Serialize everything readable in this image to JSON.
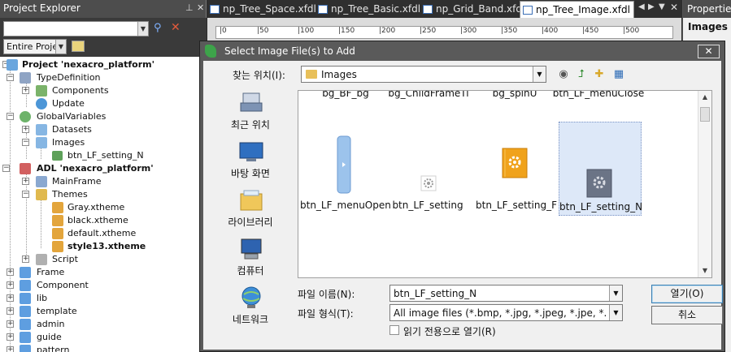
{
  "explorer": {
    "title": "Project Explorer",
    "scope_select": "Entire Projec",
    "tree": [
      {
        "label": "Project 'nexacro_platform'",
        "bold": true
      },
      {
        "label": "TypeDefinition"
      },
      {
        "label": "Components"
      },
      {
        "label": "Update"
      },
      {
        "label": "GlobalVariables"
      },
      {
        "label": "Datasets"
      },
      {
        "label": "Images"
      },
      {
        "label": "btn_LF_setting_N"
      },
      {
        "label": "ADL 'nexacro_platform'",
        "bold": true
      },
      {
        "label": "MainFrame"
      },
      {
        "label": "Themes"
      },
      {
        "label": "Gray.xtheme"
      },
      {
        "label": "black.xtheme"
      },
      {
        "label": "default.xtheme"
      },
      {
        "label": "style13.xtheme",
        "bold": true
      },
      {
        "label": "Script"
      },
      {
        "label": "Frame"
      },
      {
        "label": "Component"
      },
      {
        "label": "lib"
      },
      {
        "label": "template"
      },
      {
        "label": "admin"
      },
      {
        "label": "guide"
      },
      {
        "label": "pattern"
      }
    ]
  },
  "tabs": [
    {
      "label": "np_Tree_Space.xfdl"
    },
    {
      "label": "np_Tree_Basic.xfdl"
    },
    {
      "label": "np_Grid_Band.xfdl"
    },
    {
      "label": "np_Tree_Image.xfdl *"
    }
  ],
  "ruler": [
    "|0",
    "|50",
    "|100",
    "|150",
    "|200",
    "|250",
    "|300",
    "|350",
    "|400",
    "|450",
    "|500"
  ],
  "properties": {
    "title": "Properties",
    "selected": "Images"
  },
  "dialog": {
    "title": "Select Image File(s) to Add",
    "close_label": "✕",
    "look_in_label": "찾는 위치(I):",
    "look_in_value": "Images",
    "places": [
      {
        "label": "최근 위치"
      },
      {
        "label": "바탕 화면"
      },
      {
        "label": "라이브러리"
      },
      {
        "label": "컴퓨터"
      },
      {
        "label": "네트워크"
      }
    ],
    "files_top_row": [
      "bg_BF_bg",
      "bg_ChildFrameTi",
      "bg_spinU",
      "btn_LF_menuClose"
    ],
    "files": [
      {
        "label": "btn_LF_menuOpen"
      },
      {
        "label": "btn_LF_setting"
      },
      {
        "label": "btn_LF_setting_F"
      },
      {
        "label": "btn_LF_setting_N",
        "selected": true
      }
    ],
    "filename_label": "파일 이름(N):",
    "filename_value": "btn_LF_setting_N",
    "filetype_label": "파일 형식(T):",
    "filetype_value": "All image files (*.bmp, *.jpg, *.jpeg, *.jpe, *.jfi",
    "readonly_label": "읽기 전용으로 열기(R)",
    "open_label": "열기(O)",
    "cancel_label": "취소"
  }
}
